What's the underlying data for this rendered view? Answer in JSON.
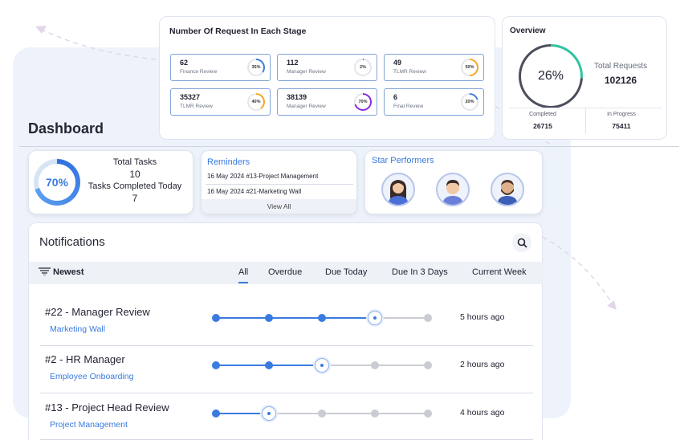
{
  "dashboard": {
    "title": "Dashboard"
  },
  "stage_panel": {
    "title": "Number Of Request In Each Stage",
    "stages": [
      {
        "count": "62",
        "label": "Finance Review",
        "percent_label": "35%",
        "percent": 35,
        "color": "#3a7be0"
      },
      {
        "count": "112",
        "label": "Manager Review",
        "percent_label": "2%",
        "percent": 2,
        "color": "#3a7be0"
      },
      {
        "count": "49",
        "label": "TLMR Review",
        "percent_label": "50%",
        "percent": 50,
        "color": "#f5a623"
      },
      {
        "count": "35327",
        "label": "TLMR Review",
        "percent_label": "40%",
        "percent": 40,
        "color": "#f5a623"
      },
      {
        "count": "38139",
        "label": "Manager Review",
        "percent_label": "70%",
        "percent": 70,
        "color": "#8a2be2"
      },
      {
        "count": "6",
        "label": "Final Review",
        "percent_label": "20%",
        "percent": 20,
        "color": "#3a7be0"
      }
    ]
  },
  "overview": {
    "title": "Overview",
    "percent_label": "26%",
    "percent": 26,
    "ring_color": "#2ec4a0",
    "total_label": "Total Requests",
    "total_value": "102126",
    "completed_label": "Completed",
    "completed_value": "26715",
    "in_progress_label": "In Progress",
    "in_progress_value": "75411"
  },
  "tasks": {
    "percent_label": "70%",
    "percent": 70,
    "total_label": "Total Tasks",
    "total_value": "10",
    "completed_label": "Tasks Completed Today",
    "completed_value": "7"
  },
  "reminders": {
    "title": "Reminders",
    "items": [
      "16 May 2024 #13-Project Management",
      "16 May 2024 #21-Marketing Wall"
    ],
    "view_all": "View All"
  },
  "star_performers": {
    "title": "Star Performers",
    "avatars": [
      "woman-avatar",
      "man-avatar",
      "bearded-man-avatar"
    ]
  },
  "notifications": {
    "title": "Notifications",
    "sort_label": "Newest",
    "tabs": [
      "All",
      "Overdue",
      "Due Today",
      "Due In 3 Days",
      "Current Week"
    ],
    "active_tab": "All",
    "rows": [
      {
        "title": "#22 - Manager Review",
        "subtitle": "Marketing Wall",
        "time": "5 hours ago",
        "steps_total": 5,
        "current_step": 4
      },
      {
        "title": "#2 - HR Manager",
        "subtitle": "Employee Onboarding",
        "time": "2 hours ago",
        "steps_total": 5,
        "current_step": 3
      },
      {
        "title": "#13 - Project Head Review",
        "subtitle": "Project Management",
        "time": "4 hours ago",
        "steps_total": 5,
        "current_step": 2
      }
    ]
  },
  "colors": {
    "accent": "#3a7be0",
    "panel_background": "#eef3fb"
  }
}
